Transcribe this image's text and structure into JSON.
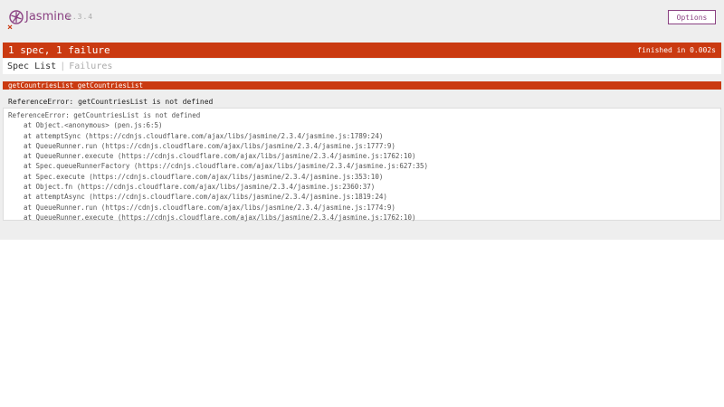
{
  "banner": {
    "logo_text": "Jasmine",
    "version": "2.3.4",
    "options_label": "Options",
    "failure_symbol": "×"
  },
  "alert": {
    "summary": "1 spec, 1 failure",
    "duration": "finished in 0.002s"
  },
  "menu": {
    "spec_list": "Spec List",
    "separator": "|",
    "failures": "Failures"
  },
  "failure": {
    "spec_name": "getCountriesList getCountriesList",
    "message": "ReferenceError: getCountriesList is not defined",
    "stack_header": "ReferenceError: getCountriesList is not defined",
    "stack": [
      "at Object.<anonymous> (pen.js:6:5)",
      "at attemptSync (https://cdnjs.cloudflare.com/ajax/libs/jasmine/2.3.4/jasmine.js:1789:24)",
      "at QueueRunner.run (https://cdnjs.cloudflare.com/ajax/libs/jasmine/2.3.4/jasmine.js:1777:9)",
      "at QueueRunner.execute (https://cdnjs.cloudflare.com/ajax/libs/jasmine/2.3.4/jasmine.js:1762:10)",
      "at Spec.queueRunnerFactory (https://cdnjs.cloudflare.com/ajax/libs/jasmine/2.3.4/jasmine.js:627:35)",
      "at Spec.execute (https://cdnjs.cloudflare.com/ajax/libs/jasmine/2.3.4/jasmine.js:353:10)",
      "at Object.fn (https://cdnjs.cloudflare.com/ajax/libs/jasmine/2.3.4/jasmine.js:2360:37)",
      "at attemptAsync (https://cdnjs.cloudflare.com/ajax/libs/jasmine/2.3.4/jasmine.js:1819:24)",
      "at QueueRunner.run (https://cdnjs.cloudflare.com/ajax/libs/jasmine/2.3.4/jasmine.js:1774:9)",
      "at QueueRunner.execute (https://cdnjs.cloudflare.com/ajax/libs/jasmine/2.3.4/jasmine.js:1762:10)"
    ]
  },
  "colors": {
    "brand": "#8a4182",
    "failure": "#ca3a11",
    "background": "#eeeeee"
  },
  "icons": {
    "logo": "jasmine-flower-icon",
    "failure": "close-icon"
  }
}
